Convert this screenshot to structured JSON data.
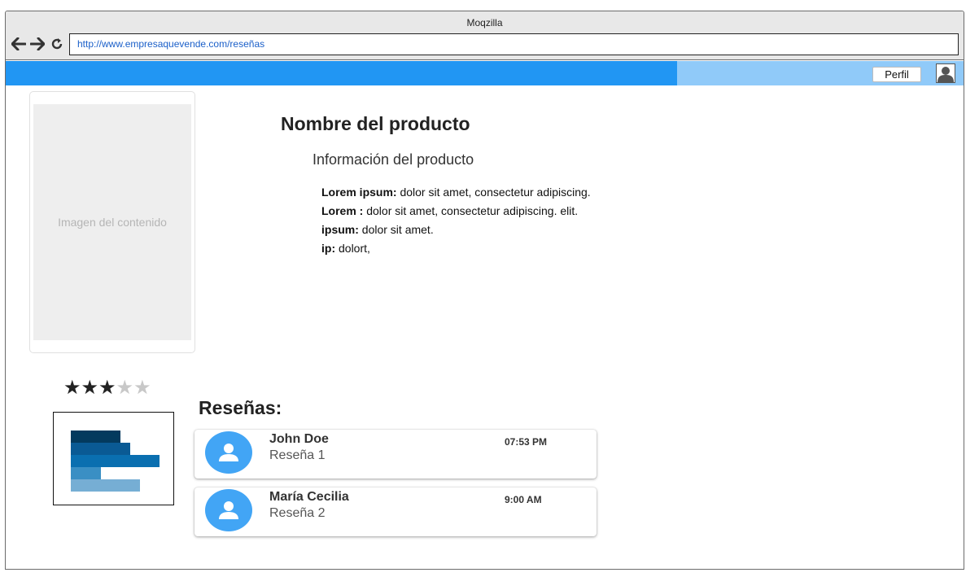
{
  "window": {
    "title": "Moqzilla"
  },
  "address_bar": {
    "url": "http://www.empresaquevende.com/reseñas"
  },
  "header": {
    "profile_label": "Perfil"
  },
  "product": {
    "image_placeholder": "Imagen del contenido",
    "title": "Nombre del producto",
    "subtitle": "Información del producto",
    "specs": [
      {
        "key": "Lorem ipsum:",
        "value": " dolor sit amet, consectetur adipiscing."
      },
      {
        "key": "Lorem :",
        "value": " dolor sit amet, consectetur adipiscing. elit."
      },
      {
        "key": "ipsum:",
        "value": " dolor sit amet."
      },
      {
        "key": "ip:",
        "value": " dolort,"
      }
    ]
  },
  "rating": {
    "stars_filled": 3,
    "stars_total": 5
  },
  "rating_breakdown_colors": [
    "#033a5e",
    "#0a5a94",
    "#0a6fb0",
    "#3a8fc4",
    "#76aed4"
  ],
  "reviews": {
    "title": "Reseñas:",
    "items": [
      {
        "author": "John Doe",
        "text": "Reseña 1",
        "time": "07:53 PM"
      },
      {
        "author": "María Cecilia",
        "text": "Reseña 2",
        "time": "9:00 AM"
      }
    ]
  },
  "colors": {
    "header_blue": "#2196f3",
    "header_light_blue": "#90caf9",
    "avatar_blue": "#42a5f5"
  }
}
